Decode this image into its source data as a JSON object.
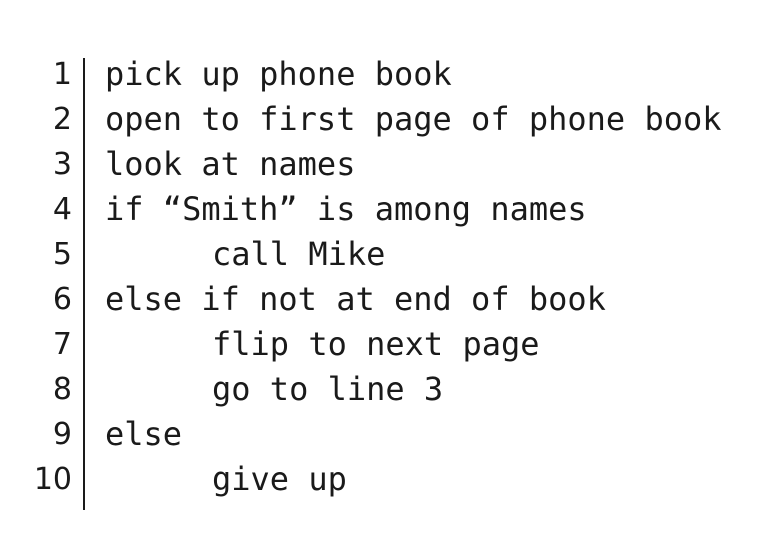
{
  "code": {
    "lines": [
      {
        "number": "1",
        "text": "pick up phone book",
        "indent": 0
      },
      {
        "number": "2",
        "text": "open to first page of phone book",
        "indent": 0
      },
      {
        "number": "3",
        "text": "look at names",
        "indent": 0
      },
      {
        "number": "4",
        "text": "if “Smith” is among names",
        "indent": 0
      },
      {
        "number": "5",
        "text": "call Mike",
        "indent": 1
      },
      {
        "number": "6",
        "text": "else if not at end of book",
        "indent": 0
      },
      {
        "number": "7",
        "text": "flip to next page",
        "indent": 1
      },
      {
        "number": "8",
        "text": "go to line 3",
        "indent": 1
      },
      {
        "number": "9",
        "text": "else",
        "indent": 0
      },
      {
        "number": "10",
        "text": "give up",
        "indent": 1
      }
    ]
  }
}
